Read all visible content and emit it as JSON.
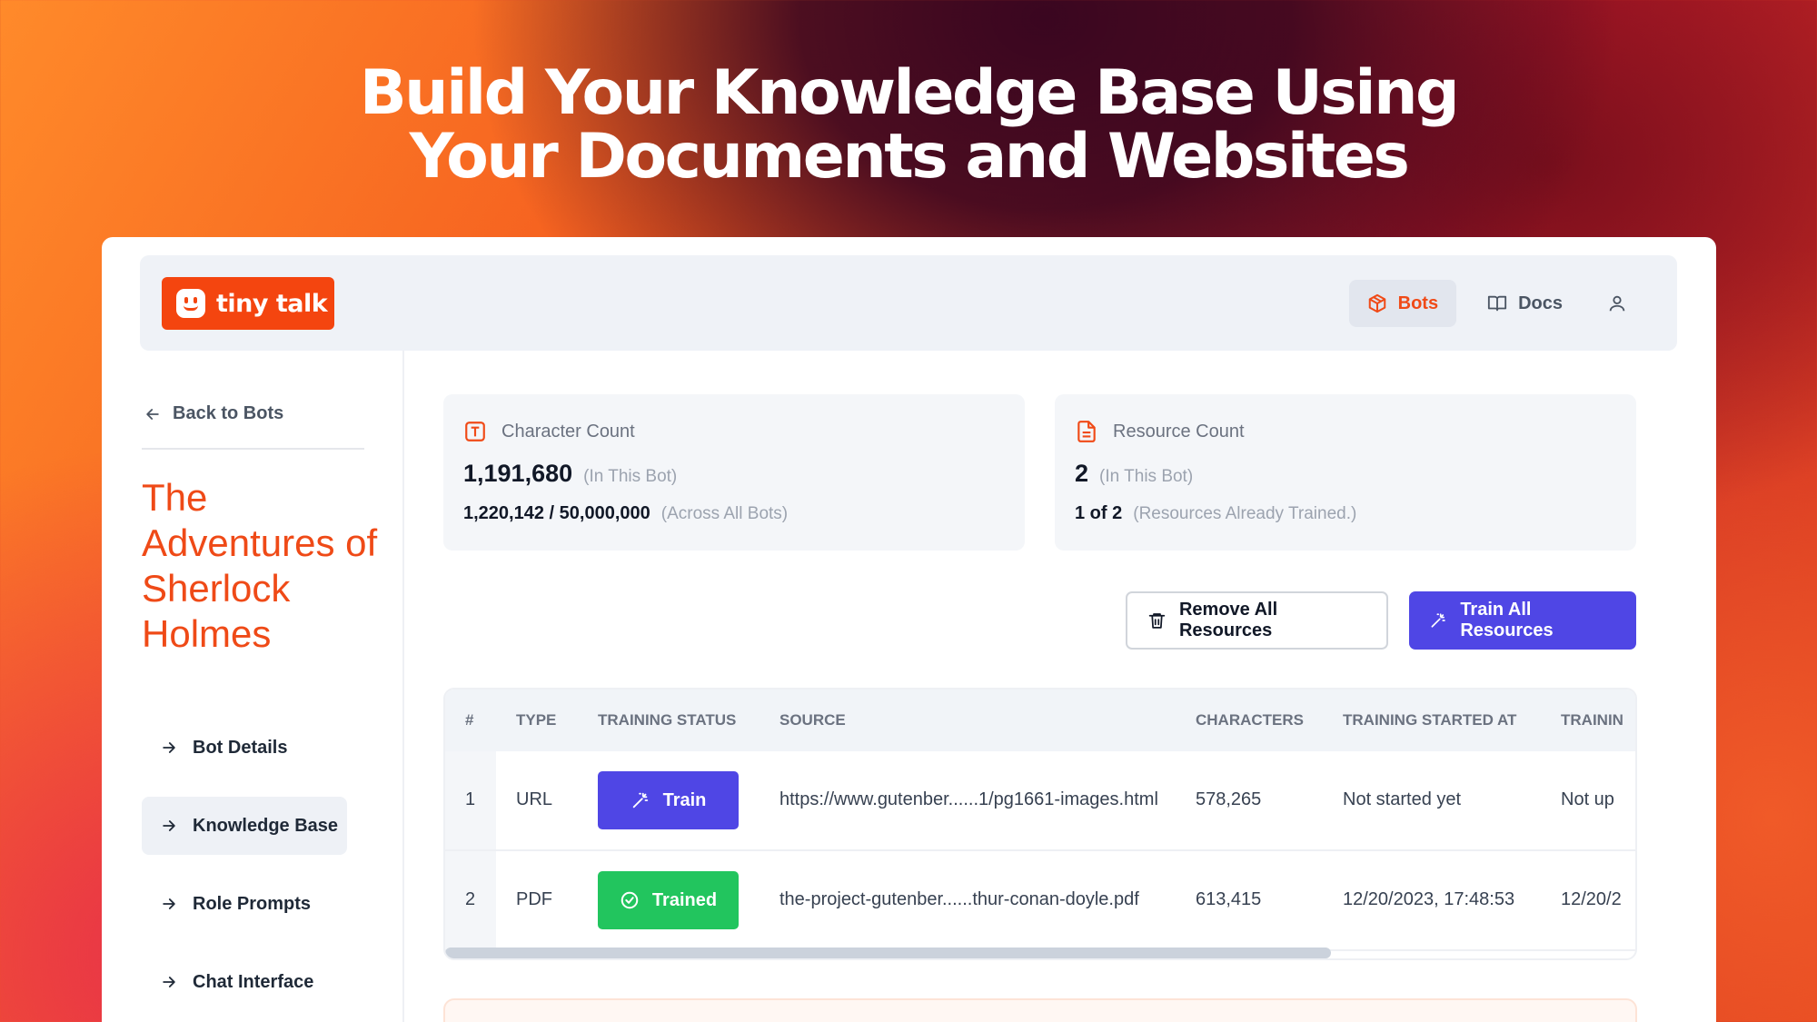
{
  "headline": {
    "line1": "Build Your Knowledge Base Using",
    "line2": "Your Documents and Websites"
  },
  "app": {
    "logo_text": "tiny talk"
  },
  "nav": {
    "bots": "Bots",
    "docs": "Docs"
  },
  "sidebar": {
    "back_label": "Back to Bots",
    "bot_title": "The Adventures of Sherlock Holmes",
    "items": [
      {
        "label": "Bot Details"
      },
      {
        "label": "Knowledge Base",
        "active": true
      },
      {
        "label": "Role Prompts"
      },
      {
        "label": "Chat Interface"
      }
    ]
  },
  "stats": {
    "characters": {
      "title": "Character Count",
      "value": "1,191,680",
      "value_note": "(In This Bot)",
      "sub_value": "1,220,142 / 50,000,000",
      "sub_note": "(Across All Bots)"
    },
    "resources": {
      "title": "Resource Count",
      "value": "2",
      "value_note": "(In This Bot)",
      "sub_value": "1 of 2",
      "sub_note": "(Resources Already Trained.)"
    }
  },
  "actions": {
    "remove_all": "Remove All Resources",
    "train_all": "Train All Resources"
  },
  "table": {
    "headers": [
      "#",
      "TYPE",
      "TRAINING STATUS",
      "SOURCE",
      "CHARACTERS",
      "TRAINING STARTED AT",
      "TRAININ"
    ],
    "rows": [
      {
        "index": "1",
        "type": "URL",
        "status": "Train",
        "source": "https://www.gutenber......1/pg1661-images.html",
        "characters": "578,265",
        "started": "Not started yet",
        "next": "Not up"
      },
      {
        "index": "2",
        "type": "PDF",
        "status": "Trained",
        "source": "the-project-gutenber......thur-conan-doyle.pdf",
        "characters": "613,415",
        "started": "12/20/2023, 17:48:53",
        "next": "12/20/2"
      }
    ]
  },
  "colors": {
    "brand": "#f4450f",
    "primary": "#4f46e5",
    "success": "#22c55e"
  }
}
